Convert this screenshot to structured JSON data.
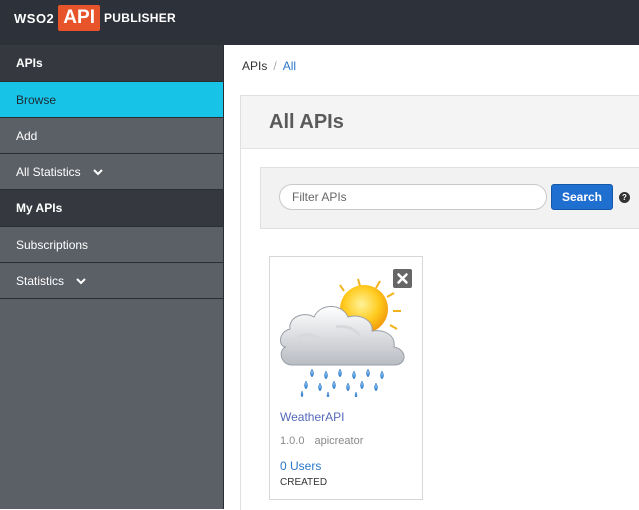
{
  "header": {
    "logo_wso2": "WSO2",
    "logo_api": "API",
    "logo_publisher": "PUBLISHER"
  },
  "sidebar": {
    "section_apis": "APIs",
    "items_apis": [
      {
        "label": "Browse"
      },
      {
        "label": "Add"
      },
      {
        "label": "All Statistics"
      }
    ],
    "section_my_apis": "My APIs",
    "items_my_apis": [
      {
        "label": "Subscriptions"
      },
      {
        "label": "Statistics"
      }
    ]
  },
  "breadcrumb": {
    "root": "APIs",
    "separator": "/",
    "current": "All"
  },
  "main": {
    "title": "All APIs",
    "filter_placeholder": "Filter APIs",
    "search_label": "Search",
    "help_glyph": "?"
  },
  "api_card": {
    "name": "WeatherAPI",
    "version": "1.0.0",
    "provider": "apicreator",
    "users": "0 Users",
    "status": "CREATED",
    "thumbnail_icon": "weather-rain-sun-icon"
  },
  "colors": {
    "topbar": "#2d3139",
    "sidebar": "#5b5f66",
    "sidebar_header": "#35393f",
    "active_item": "#17c4e8",
    "brand_orange": "#e8542a",
    "primary_button": "#1f6fd1",
    "link": "#2a77c9"
  }
}
